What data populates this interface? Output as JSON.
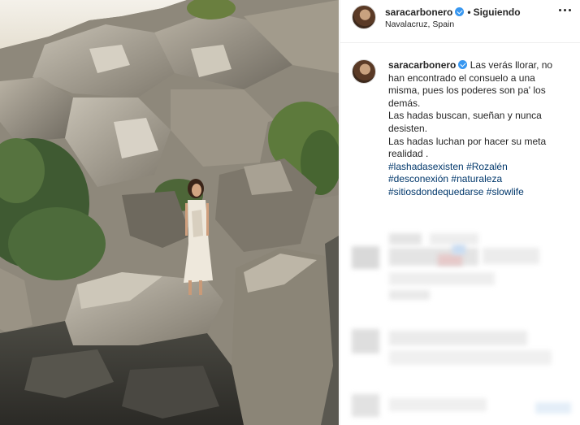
{
  "post": {
    "username": "saracarbonero",
    "follow_label": "Siguiendo",
    "location": "Navalacruz, Spain",
    "verified": true,
    "more_icon": "ellipsis-icon"
  },
  "caption": {
    "username": "saracarbonero",
    "lines": [
      "Las verás llorar, no han encontrado el consuelo a una misma, pues los poderes son pa' los demás.",
      "Las hadas buscan, sueñan y nunca desisten.",
      "Las hadas luchan por hacer su meta realidad ."
    ],
    "hashtags": [
      "#lashadasexisten",
      "#Rozalén",
      "#desconexión",
      "#naturaleza",
      "#sitiosdondequedarse",
      "#slowlife"
    ]
  },
  "colors": {
    "link": "#00376b",
    "verified": "#3897f0",
    "border": "#efefef"
  }
}
